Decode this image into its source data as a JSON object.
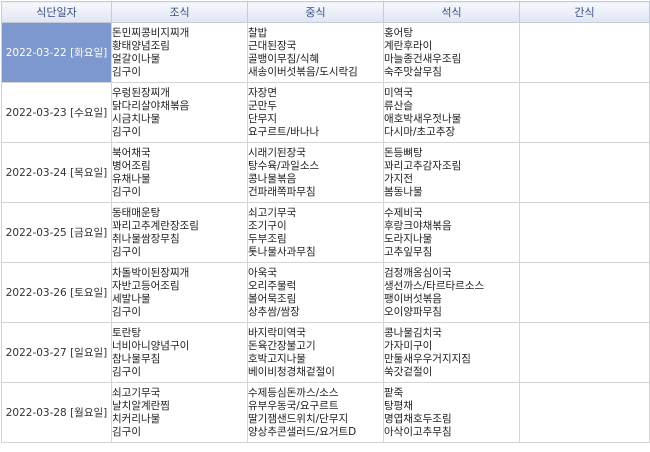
{
  "headers": [
    "식단일자",
    "조식",
    "중식",
    "석식",
    "간식"
  ],
  "selected_row": 0,
  "rows": [
    {
      "date": "2022-03-22 [화요일]",
      "breakfast": [
        "돈민찌콩비지찌개",
        "황태양념조림",
        "얼갈이나물",
        "김구이"
      ],
      "lunch": [
        "찰밥",
        "근대된장국",
        "골뱅이무침/식혜",
        "새송이버섯볶음/도시락김"
      ],
      "dinner": [
        "홍어탕",
        "계란후라이",
        "마늘종건새우조림",
        "숙주맛살무침"
      ],
      "snack": []
    },
    {
      "date": "2022-03-23 [수요일]",
      "breakfast": [
        "우렁된장찌개",
        "닭다리살야채볶음",
        "시금치나물",
        "김구이"
      ],
      "lunch": [
        "자장면",
        "군만두",
        "단무지",
        "요구르트/바나나"
      ],
      "dinner": [
        "미역국",
        "류산슬",
        "애호박새우젓나물",
        "다시마/초고추장"
      ],
      "snack": []
    },
    {
      "date": "2022-03-24 [목요일]",
      "breakfast": [
        "북어채국",
        "병어조림",
        "유채나물",
        "김구이"
      ],
      "lunch": [
        "시래기된장국",
        "탕수육/과일소스",
        "콩나물볶음",
        "건파래쪽파무침"
      ],
      "dinner": [
        "돈등뼈탕",
        "꽈리고추감자조림",
        "가지전",
        "봄동나물"
      ],
      "snack": []
    },
    {
      "date": "2022-03-25 [금요일]",
      "breakfast": [
        "동태매운탕",
        "꽈리고추계란장조림",
        "취나물쌈장무침",
        "김구이"
      ],
      "lunch": [
        "쇠고기무국",
        "조기구이",
        "두부조림",
        "톳나물사과무침"
      ],
      "dinner": [
        "수제비국",
        "후랑크야채볶음",
        "도라지나물",
        "고추잎무침"
      ],
      "snack": []
    },
    {
      "date": "2022-03-26 [토요일]",
      "breakfast": [
        "차돌박이된장찌개",
        "자반고등어조림",
        "세발나물",
        "김구이"
      ],
      "lunch": [
        "아욱국",
        "오리주물럭",
        "볼어묵조림",
        "상추쌈/쌈장"
      ],
      "dinner": [
        "검정깨옹심이국",
        "생선까스/타르타르소스",
        "팽이버섯볶음",
        "오이양파무침"
      ],
      "snack": []
    },
    {
      "date": "2022-03-27 [일요일]",
      "breakfast": [
        "토란탕",
        "너비아니양념구이",
        "참나물무침",
        "김구이"
      ],
      "lunch": [
        "바지락미역국",
        "돈육간장불고기",
        "호박고지나물",
        "베이비청경채겉절이"
      ],
      "dinner": [
        "콩나물김치국",
        "가자미구이",
        "만둘새우우거지지짐",
        "쑥갓겉절이"
      ],
      "snack": []
    },
    {
      "date": "2022-03-28 [월요일]",
      "breakfast": [
        "쇠고기무국",
        "날치알계란찜",
        "치커리나물",
        "김구이"
      ],
      "lunch": [
        "수제등심돈까스/소스",
        "유부우동국/요구르트",
        "딸기잼샌드위치/단무지",
        "양상추콘샐러드/요거트D"
      ],
      "dinner": [
        "팥죽",
        "탕평채",
        "명엽채호두조림",
        "아삭이고추무침"
      ],
      "snack": []
    }
  ]
}
